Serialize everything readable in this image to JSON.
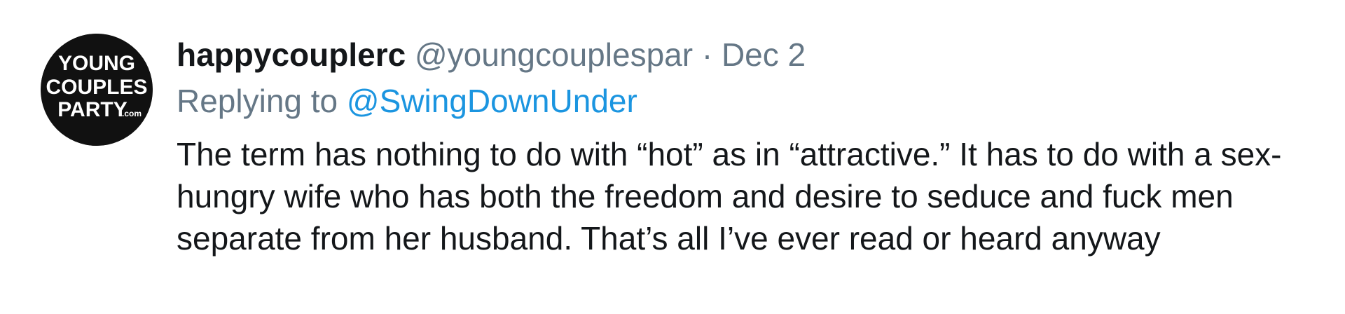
{
  "tweet": {
    "avatar": {
      "line1": "YOUNG",
      "line2": "COUPLES",
      "line3": "PARTY",
      "line3_suffix": ".com",
      "bg_color": "#111111",
      "text_color": "#ffffff"
    },
    "display_name": "happycouplerc",
    "handle": "@youngcouplespar",
    "separator": "·",
    "date": "Dec 2",
    "reply_prefix": "Replying to",
    "reply_target": "@SwingDownUnder",
    "body": "The term has nothing to do with “hot” as in “attractive.” It has to do with a sex-hungry wife who has both the freedom and desire to seduce and fuck men separate from her husband. That’s all I’ve ever read or heard anyway",
    "colors": {
      "name": "#14171a",
      "secondary": "#657786",
      "link": "#1b95e0"
    }
  }
}
